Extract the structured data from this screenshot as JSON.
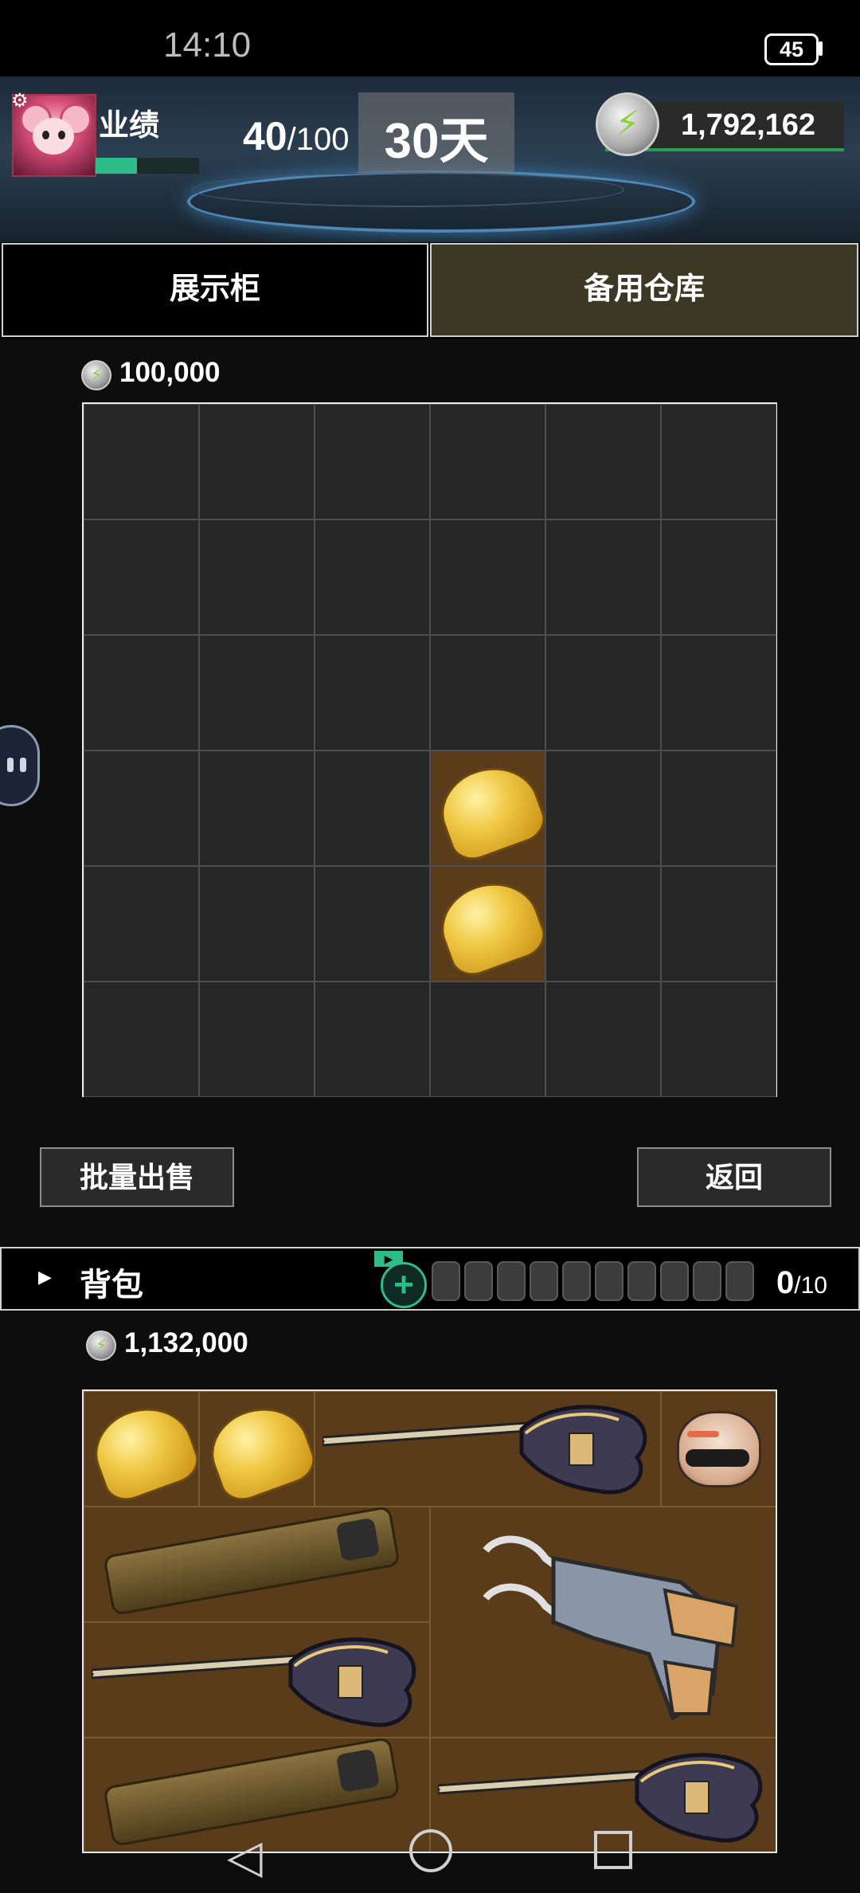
{
  "status": {
    "time": "14:10",
    "battery": "45"
  },
  "header": {
    "performance_label": "业绩",
    "performance_value": "40",
    "performance_max": "/100",
    "performance_fraction": 0.4,
    "days": "30天",
    "currency": "1,792,162"
  },
  "tabs": {
    "display_case": "展示柜",
    "backup_storage": "备用仓库",
    "active": "backup_storage"
  },
  "storage": {
    "price": "100,000",
    "grid_rows": 6,
    "grid_cols": 6,
    "items": [
      {
        "name": "bun",
        "row": 3,
        "col": 3
      },
      {
        "name": "bun",
        "row": 4,
        "col": 3
      }
    ]
  },
  "actions": {
    "batch_sell": "批量出售",
    "back": "返回"
  },
  "backpack": {
    "label": "背包",
    "ad_tag": "▶",
    "slot_count": "0",
    "slot_max": "/10",
    "slots": 10,
    "price": "1,132,000",
    "items": [
      "bun",
      "bun",
      "electric-guitar",
      "helmet",
      "phone",
      "overalls",
      "electric-guitar",
      "phone",
      "electric-guitar"
    ]
  },
  "colors": {
    "accent_green": "#2ebd8a",
    "tab_active": "#3b3824",
    "item_cell": "#5a3b1a"
  }
}
